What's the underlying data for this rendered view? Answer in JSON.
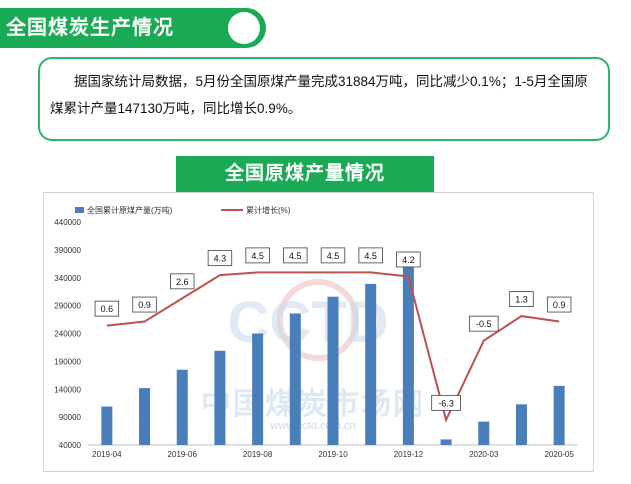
{
  "section": {
    "title": "全国煤炭生产情况"
  },
  "summary": {
    "text": "据国家统计局数据，5月份全国原煤产量完成31884万吨，同比减少0.1%；1-5月全国原煤累计产量147130万吨，同比增长0.9%。"
  },
  "chart_banner": {
    "title": "全国原煤产量情况"
  },
  "watermark": {
    "logo": "CCTD",
    "name": "中国煤炭市场网",
    "url": "www.cctd.com.cn"
  },
  "colors": {
    "green": "#1aaa55",
    "bar": "#4a7ebb",
    "line": "#c0504d"
  },
  "chart_data": {
    "type": "bar",
    "categories": [
      "2019-04",
      "2019-05",
      "2019-06",
      "2019-07",
      "2019-08",
      "2019-09",
      "2019-10",
      "2019-11",
      "2019-12",
      "2020-02",
      "2020-03",
      "2020-04",
      "2020-05"
    ],
    "x_tick_labels": [
      "2019-04",
      "2019-06",
      "2019-08",
      "2019-10",
      "2019-12",
      "2020-03",
      "2020-05"
    ],
    "series": [
      {
        "name": "全国累计原煤产量(万吨)",
        "type": "bar",
        "values": [
          109000,
          142000,
          175000,
          209000,
          240000,
          276000,
          306000,
          329000,
          373000,
          50000,
          82000,
          113000,
          146000
        ]
      },
      {
        "name": "累计增长(%)",
        "type": "line",
        "values": [
          0.6,
          0.9,
          2.6,
          4.3,
          4.5,
          4.5,
          4.5,
          4.5,
          4.2,
          -6.3,
          -0.5,
          1.3,
          0.9
        ]
      }
    ],
    "ylim": [
      40000,
      440000
    ],
    "y_ticks": [
      40000,
      90000,
      140000,
      190000,
      240000,
      290000,
      340000,
      390000,
      440000
    ],
    "y2lim": [
      -8.14,
      8.19
    ],
    "legend_position": "top-left",
    "grid": false
  }
}
